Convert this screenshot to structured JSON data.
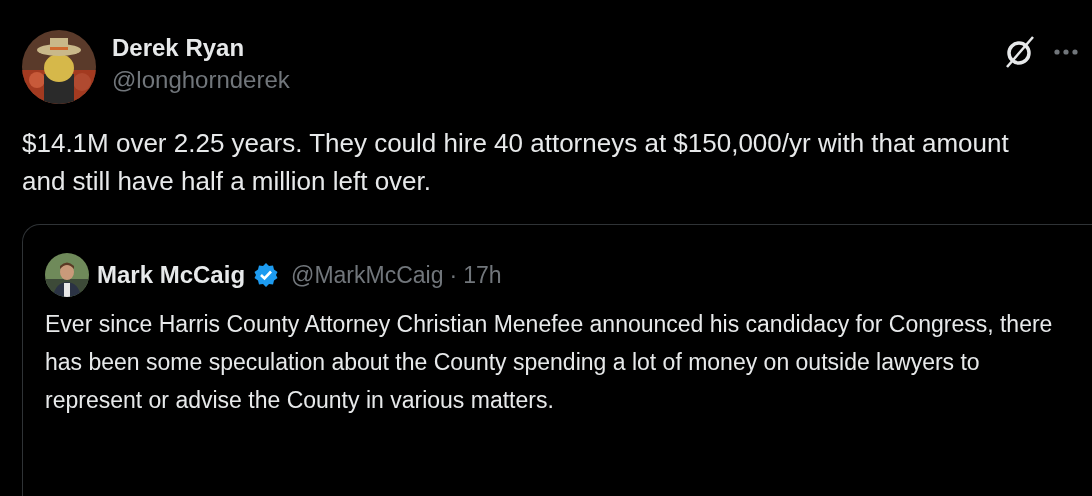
{
  "post": {
    "author": "Derek Ryan",
    "handle": "@longhornderek",
    "text": "$14.1M over 2.25 years. They could hire 40 attorneys at $150,000/yr with that amount and still have half a million left over."
  },
  "quote": {
    "author": "Mark McCaig",
    "verified": true,
    "handle": "@MarkMcCaig",
    "separator": "·",
    "time": "17h",
    "text": "Ever since Harris County Attorney Christian Menefee announced his candidacy for Congress, there has been some speculation about the County spending a lot of money on outside lawyers to represent or advise the County in various matters."
  }
}
